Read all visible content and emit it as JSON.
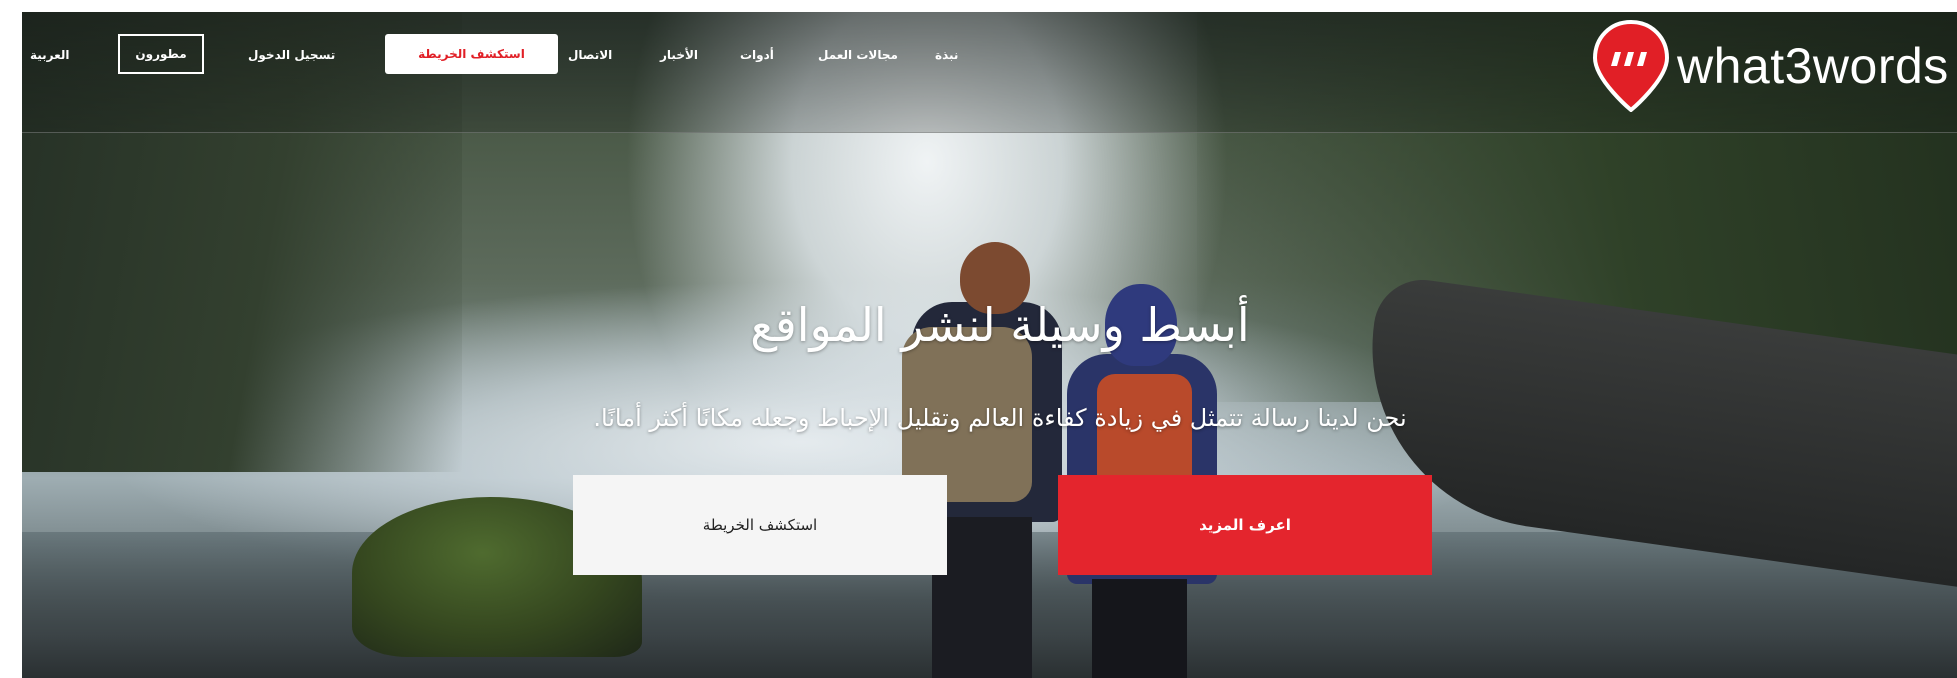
{
  "brand": {
    "name": "what3words",
    "logo_icon": "triple-slash-pin-icon",
    "accent": "#e11f26"
  },
  "nav": {
    "language": "العربية",
    "developers": "مطورون",
    "login": "تسجيل الدخول",
    "explore_map": "استكشف الخريطة",
    "contact": "الاتصال",
    "news": "الأخبار",
    "tools": "أدوات",
    "industries": "مجالات العمل",
    "about": "نبذة"
  },
  "hero": {
    "headline": "أبسط وسيلة لنشر المواقع",
    "subheadline": "نحن لدينا رسالة تتمثل في زيادة كفاءة العالم وتقليل الإحباط وجعله مكانًا أكثر أمانًا.",
    "explore_button": "استكشف الخريطة",
    "learn_more_button": "اعرف المزيد"
  }
}
